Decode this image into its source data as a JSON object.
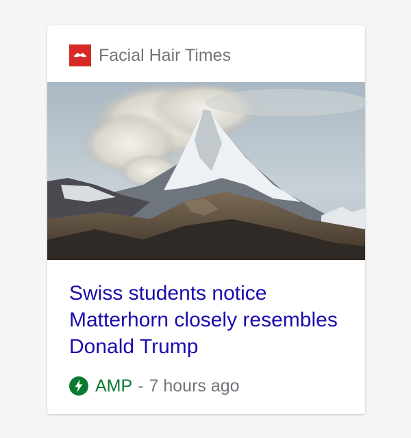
{
  "publisher": {
    "name": "Facial Hair Times",
    "logo_icon": "mustache-icon",
    "logo_color": "#d62a26"
  },
  "article": {
    "image_icon": "matterhorn-mountain-photo",
    "headline": "Swiss students notice Matterhorn closely resembles Donald Trump",
    "headline_color": "#1a0dab"
  },
  "meta": {
    "amp_icon": "amp-lightning-icon",
    "amp_label": "AMP",
    "amp_color": "#0a7a31",
    "separator": "-",
    "time": "7 hours ago"
  }
}
